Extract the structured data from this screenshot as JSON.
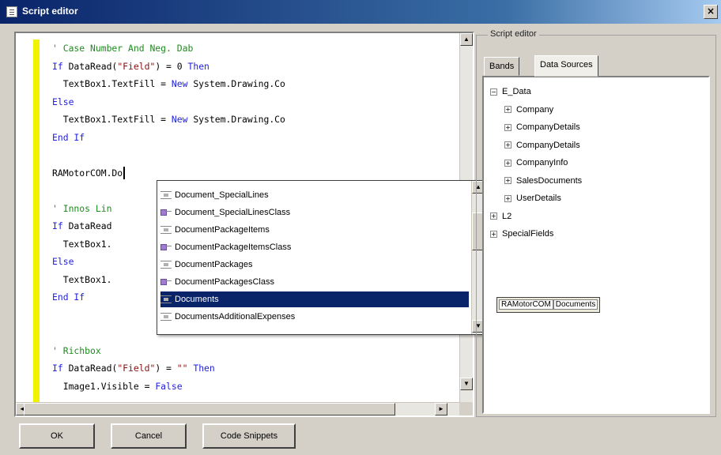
{
  "window": {
    "title": "Script editor"
  },
  "code_lines": [
    [
      {
        "t": "' Case Number And Neg. Dab",
        "c": "c-comment"
      }
    ],
    [
      {
        "t": "If ",
        "c": "c-kw"
      },
      {
        "t": "DataRead(",
        "c": "c-txt"
      },
      {
        "t": "\"Field\"",
        "c": "c-str"
      },
      {
        "t": ") = 0 ",
        "c": "c-txt"
      },
      {
        "t": "Then",
        "c": "c-kw"
      }
    ],
    [
      {
        "t": "  TextBox1.TextFill = ",
        "c": "c-txt"
      },
      {
        "t": "New ",
        "c": "c-kw"
      },
      {
        "t": "System.Drawing.Co",
        "c": "c-txt"
      }
    ],
    [
      {
        "t": "Else",
        "c": "c-kw"
      }
    ],
    [
      {
        "t": "  TextBox1.TextFill = ",
        "c": "c-txt"
      },
      {
        "t": "New ",
        "c": "c-kw"
      },
      {
        "t": "System.Drawing.Co",
        "c": "c-txt"
      }
    ],
    [
      {
        "t": "End If",
        "c": "c-kw"
      }
    ],
    [],
    [
      {
        "t": "RAMotorCOM.Do",
        "c": "c-txt"
      }
    ],
    [],
    [
      {
        "t": "' Innos Lin",
        "c": "c-comment"
      }
    ],
    [
      {
        "t": "If ",
        "c": "c-kw"
      },
      {
        "t": "DataRead",
        "c": "c-txt"
      }
    ],
    [
      {
        "t": "  TextBox1.",
        "c": "c-txt"
      }
    ],
    [
      {
        "t": "Else",
        "c": "c-kw"
      }
    ],
    [
      {
        "t": "  TextBox1.",
        "c": "c-txt"
      }
    ],
    [
      {
        "t": "End If",
        "c": "c-kw"
      }
    ],
    [],
    [],
    [
      {
        "t": "' Richbox",
        "c": "c-comment"
      }
    ],
    [
      {
        "t": "If ",
        "c": "c-kw"
      },
      {
        "t": "DataRead(",
        "c": "c-txt"
      },
      {
        "t": "\"Field\"",
        "c": "c-str"
      },
      {
        "t": ") = ",
        "c": "c-txt"
      },
      {
        "t": "\"\" ",
        "c": "c-str"
      },
      {
        "t": "Then",
        "c": "c-kw"
      }
    ],
    [
      {
        "t": "  Image1.Visible = ",
        "c": "c-txt"
      },
      {
        "t": "False",
        "c": "c-kw"
      }
    ]
  ],
  "autocomplete": {
    "items": [
      {
        "label": "Document_SpecialLines",
        "icon": "prop"
      },
      {
        "label": "Document_SpecialLinesClass",
        "icon": "cls"
      },
      {
        "label": "DocumentPackageItems",
        "icon": "prop"
      },
      {
        "label": "DocumentPackageItemsClass",
        "icon": "cls"
      },
      {
        "label": "DocumentPackages",
        "icon": "prop"
      },
      {
        "label": "DocumentPackagesClass",
        "icon": "cls"
      },
      {
        "label": "Documents",
        "icon": "prop"
      },
      {
        "label": "DocumentsAdditionalExpenses",
        "icon": "prop"
      }
    ],
    "selected_index": 6
  },
  "right_panel": {
    "group_label": "Script editor",
    "tabs": [
      "Bands",
      "Data Sources"
    ],
    "active_tab": 1,
    "tree": [
      {
        "label": "E_Data",
        "exp": "−",
        "level": 0
      },
      {
        "label": "Company",
        "exp": "+",
        "level": 1
      },
      {
        "label": "CompanyDetails",
        "exp": "+",
        "level": 1
      },
      {
        "label": "CompanyDetails",
        "exp": "+",
        "level": 1
      },
      {
        "label": "CompanyInfo",
        "exp": "+",
        "level": 1
      },
      {
        "label": "SalesDocuments",
        "exp": "+",
        "level": 1
      },
      {
        "label": "UserDetails",
        "exp": "+",
        "level": 1
      },
      {
        "label": "L2",
        "exp": "+",
        "level": 0
      },
      {
        "label": "SpecialFields",
        "exp": "+",
        "level": 0
      }
    ],
    "path_parts": [
      "RAMotorCOM",
      "Documents"
    ]
  },
  "buttons": {
    "ok": "OK",
    "cancel": "Cancel",
    "code_snippets": "Code Snippets"
  },
  "icons": {
    "close": "close-icon",
    "app": "script-editor-icon"
  }
}
